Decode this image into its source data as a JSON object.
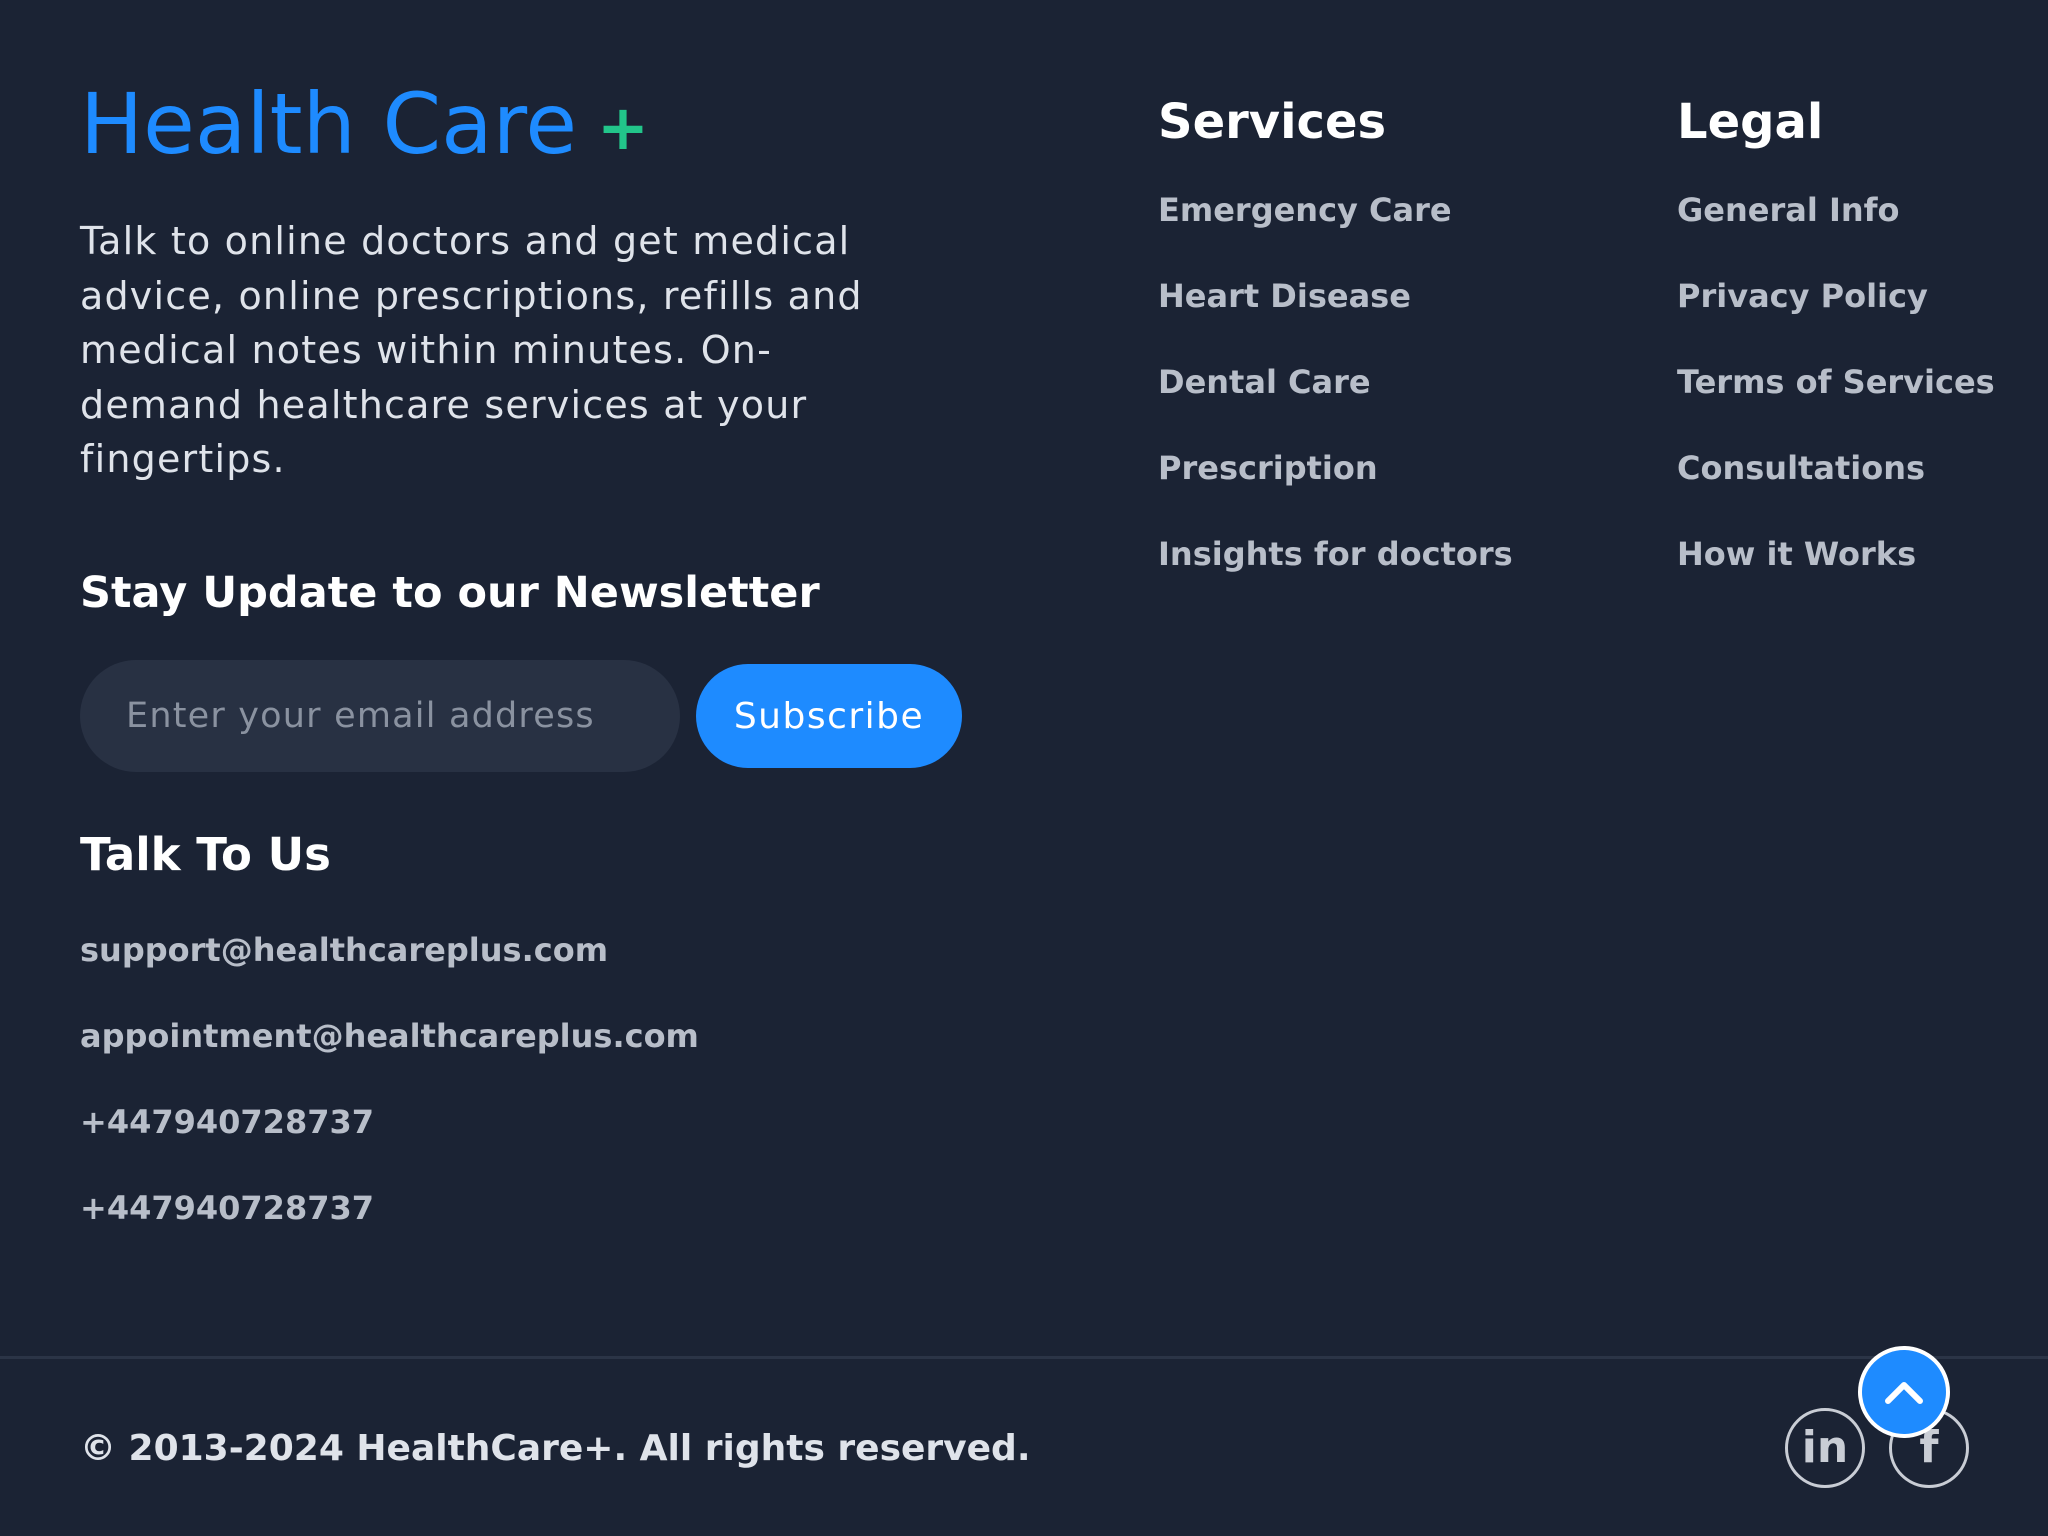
{
  "brand": {
    "name": "Health Care",
    "mark": "+"
  },
  "tagline": "Talk to online doctors and get medical advice, online prescriptions, refills and medical notes within minutes. On-demand healthcare services at your fingertips.",
  "newsletter": {
    "title": "Stay Update to our Newsletter",
    "email_placeholder": "Enter your email address",
    "email_value": "",
    "subscribe_label": "Subscribe"
  },
  "contact": {
    "title": "Talk To Us",
    "items": [
      "support@healthcareplus.com",
      "appointment@healthcareplus.com",
      "+447940728737",
      "+447940728737"
    ]
  },
  "services": {
    "title": "Services",
    "items": [
      "Emergency Care",
      "Heart Disease",
      "Dental Care",
      "Prescription",
      "Insights for doctors"
    ]
  },
  "legal": {
    "title": "Legal",
    "items": [
      "General Info",
      "Privacy Policy",
      "Terms of Services",
      "Consultations",
      "How it Works"
    ]
  },
  "footer": {
    "copyright": "© 2013-2024 HealthCare+. All rights reserved.",
    "social": [
      {
        "name": "linkedin-icon",
        "glyph": "in"
      },
      {
        "name": "facebook-icon",
        "glyph": "f"
      }
    ],
    "scroll_top_icon": "chevron-up-icon"
  },
  "colors": {
    "background": "#1b2334",
    "accent": "#1e8bff",
    "plus_green": "#22c58a",
    "input_bg": "#283143",
    "link_text": "#b8bec9",
    "heading_text": "#ffffff"
  }
}
